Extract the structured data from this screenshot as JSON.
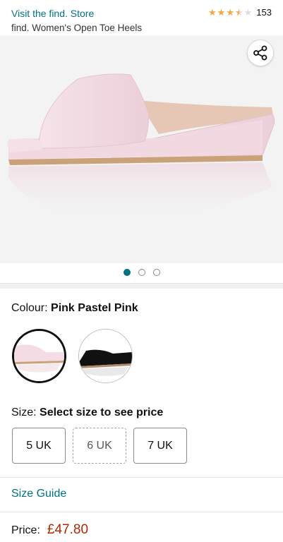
{
  "header": {
    "store_link": "Visit the find. Store",
    "product_title": "find. Women's Open Toe Heels",
    "rating": 3.5,
    "rating_max": 5,
    "review_count": "153"
  },
  "gallery": {
    "share_icon": "share-icon",
    "current_image": 1,
    "image_count": 3,
    "shoe_color": "#f5dfe6"
  },
  "colour": {
    "label": "Colour:",
    "value": "Pink Pastel Pink",
    "swatches": [
      {
        "name": "Pink Pastel Pink",
        "color": "#f3dce3",
        "selected": true
      },
      {
        "name": "Black",
        "color": "#111111",
        "selected": false
      }
    ]
  },
  "size": {
    "label": "Size:",
    "value": "Select size to see price",
    "options": [
      "5 UK",
      "6 UK",
      "7 UK"
    ]
  },
  "size_guide": "Size Guide",
  "price": {
    "label": "Price:",
    "value": "£47.80"
  },
  "colors": {
    "link": "#007185",
    "price": "#b12704",
    "star": "#f3a847"
  }
}
